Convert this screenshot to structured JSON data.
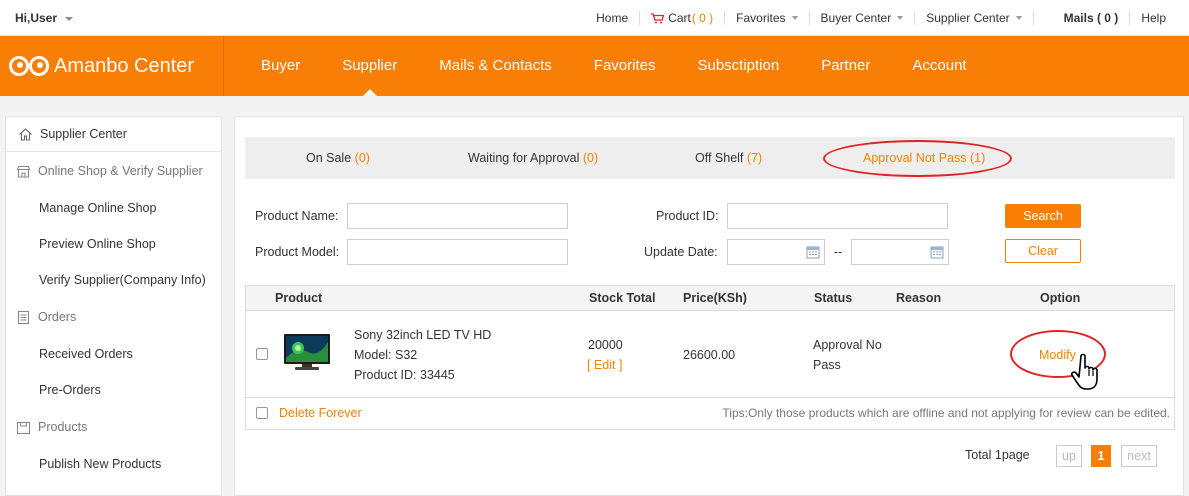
{
  "topbar": {
    "greeting": "Hi,User",
    "links": {
      "home": "Home",
      "cart_label": "Cart",
      "cart_count": "( 0 )",
      "favorites": "Favorites",
      "buyer_center": "Buyer Center",
      "supplier_center": "Supplier Center",
      "mails": "Mails ( 0 )",
      "help": "Help"
    }
  },
  "nav": {
    "logo_text": "Amanbo Center",
    "items": [
      "Buyer",
      "Supplier",
      "Mails & Contacts",
      "Favorites",
      "Subsctiption",
      "Partner",
      "Account"
    ],
    "active": "Supplier"
  },
  "sidebar": {
    "header": "Supplier Center",
    "sections": [
      {
        "title": "Online Shop & Verify Supplier",
        "icon": "shop-icon",
        "items": [
          "Manage Online Shop",
          "Preview Online Shop",
          "Verify Supplier(Company Info)"
        ]
      },
      {
        "title": "Orders",
        "icon": "orders-icon",
        "items": [
          "Received Orders",
          "Pre-Orders"
        ]
      },
      {
        "title": "Products",
        "icon": "products-icon",
        "items": [
          "Publish New Products"
        ]
      }
    ]
  },
  "tabs": [
    {
      "label": "On Sale",
      "count": "(0)"
    },
    {
      "label": "Waiting for Approval",
      "count": "(0)"
    },
    {
      "label": "Off Shelf",
      "count": "(7)"
    },
    {
      "label": "Approval Not Pass",
      "count": "(1)"
    }
  ],
  "form": {
    "product_name_label": "Product Name:",
    "product_model_label": "Product Model:",
    "product_id_label": "Product ID:",
    "update_date_label": "Update Date:",
    "date_separator": "--",
    "search_button": "Search",
    "clear_button": "Clear"
  },
  "table": {
    "headers": [
      "Product",
      "Stock Total",
      "Price(KSh)",
      "Status",
      "Reason",
      "Option"
    ],
    "rows": [
      {
        "name": "Sony 32inch LED TV HD",
        "model": "Model: S32",
        "product_id": "Product ID: 33445",
        "stock": "20000",
        "edit": "[ Edit ]",
        "price": "26600.00",
        "status_line1": "Approval No",
        "status_line2": "Pass",
        "reason": "",
        "option": "Modify"
      }
    ],
    "delete_forever": "Delete Forever",
    "tips": "Tips:Only those products which are offline and not applying for review can be edited."
  },
  "pager": {
    "total": "Total 1page",
    "up": "up",
    "current": "1",
    "next": "next"
  },
  "colors": {
    "accent": "#f97e05",
    "highlight": "#e02323"
  }
}
